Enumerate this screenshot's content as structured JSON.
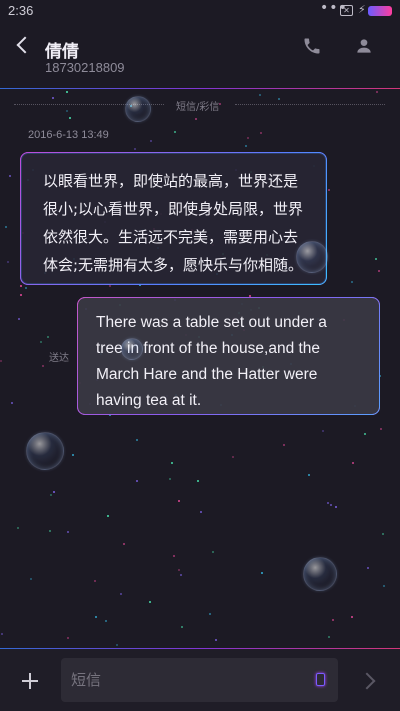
{
  "status_bar": {
    "time": "2:36",
    "more": "•••",
    "sim_badge": "✕"
  },
  "header": {
    "contact_name": "倩倩",
    "contact_number": "18730218809"
  },
  "divider": {
    "label": "短信/彩信"
  },
  "messages": [
    {
      "direction": "incoming",
      "timestamp": "2016-6-13 13:49",
      "lines": [
        "以眼看世界，即使站的最高，世界还是",
        "很小;以心看世界，即使身处局限，世界",
        "依然很大。生活远不完美，需要用心去",
        "体会;无需拥有太多，愿快乐与你相随。"
      ]
    },
    {
      "direction": "outgoing",
      "status": "送达",
      "lines": [
        "There was a table set out under a",
        "tree in front of the house,and the",
        "March Hare and the Hatter were",
        "having tea at it."
      ]
    }
  ],
  "composer": {
    "placeholder": "短信"
  },
  "colors": {
    "background": "#1c1a24",
    "accent_blue": "#3a7cff",
    "accent_purple": "#9a3cff",
    "accent_pink": "#ff3d8e"
  },
  "icons": [
    "back-icon",
    "phone-icon",
    "contact-icon",
    "add-icon",
    "sim-card-icon",
    "send-icon"
  ]
}
